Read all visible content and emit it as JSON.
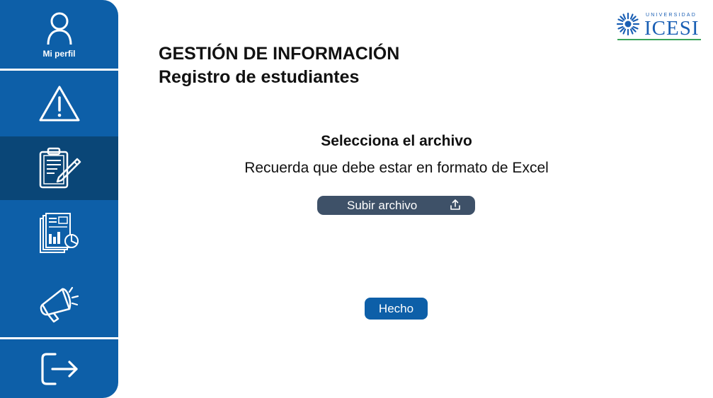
{
  "sidebar": {
    "profile_label": "Mi perfil",
    "items": [
      {
        "icon": "user-icon",
        "label": "Mi perfil"
      },
      {
        "icon": "warning-icon"
      },
      {
        "icon": "clipboard-edit-icon",
        "active": true
      },
      {
        "icon": "reports-icon"
      },
      {
        "icon": "megaphone-icon"
      },
      {
        "icon": "logout-icon"
      }
    ]
  },
  "logo": {
    "small": "UNIVERSIDAD",
    "name": "ICESI"
  },
  "header": {
    "title": "GESTIÓN DE INFORMACIÓN",
    "subtitle": "Registro de estudiantes"
  },
  "upload": {
    "heading": "Selecciona el archivo",
    "description": "Recuerda que debe estar en formato de Excel",
    "button_label": "Subir archivo",
    "icon": "upload-icon"
  },
  "actions": {
    "done_label": "Hecho"
  },
  "colors": {
    "sidebar": "#0d5fa8",
    "sidebar_active": "#0a4677",
    "upload_button": "#3e5168",
    "done_button": "#0d5fa8",
    "logo_blue": "#1a5fb4",
    "logo_green": "#3aa35a"
  }
}
